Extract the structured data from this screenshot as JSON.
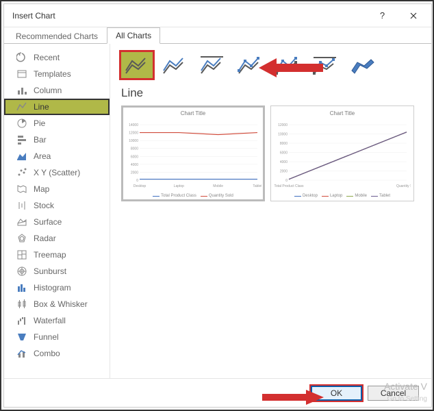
{
  "titlebar": {
    "title": "Insert Chart"
  },
  "tabs": {
    "recommended": "Recommended Charts",
    "all": "All Charts"
  },
  "sidebar": {
    "items": [
      {
        "label": "Recent",
        "icon": "recent"
      },
      {
        "label": "Templates",
        "icon": "templates"
      },
      {
        "label": "Column",
        "icon": "column"
      },
      {
        "label": "Line",
        "icon": "line"
      },
      {
        "label": "Pie",
        "icon": "pie"
      },
      {
        "label": "Bar",
        "icon": "bar"
      },
      {
        "label": "Area",
        "icon": "area"
      },
      {
        "label": "X Y (Scatter)",
        "icon": "scatter"
      },
      {
        "label": "Map",
        "icon": "map"
      },
      {
        "label": "Stock",
        "icon": "stock"
      },
      {
        "label": "Surface",
        "icon": "surface"
      },
      {
        "label": "Radar",
        "icon": "radar"
      },
      {
        "label": "Treemap",
        "icon": "treemap"
      },
      {
        "label": "Sunburst",
        "icon": "sunburst"
      },
      {
        "label": "Histogram",
        "icon": "histogram"
      },
      {
        "label": "Box & Whisker",
        "icon": "box"
      },
      {
        "label": "Waterfall",
        "icon": "waterfall"
      },
      {
        "label": "Funnel",
        "icon": "funnel"
      },
      {
        "label": "Combo",
        "icon": "combo"
      }
    ]
  },
  "section_title": "Line",
  "preview1": {
    "title": "Chart Title",
    "xcats": [
      "Desktop",
      "Laptop",
      "Mobile",
      "Tablet"
    ],
    "legend": [
      "Total Product Class",
      "Quantity Sold"
    ]
  },
  "preview2": {
    "title": "Chart Title",
    "xcats": [
      "Total Product Class",
      "Quantity Sold"
    ],
    "legend": [
      "Desktop",
      "Laptop",
      "Mobile",
      "Tablet"
    ]
  },
  "chart_data": [
    {
      "type": "line",
      "title": "Chart Title",
      "categories": [
        "Desktop",
        "Laptop",
        "Mobile",
        "Tablet"
      ],
      "series": [
        {
          "name": "Total Product Class",
          "values": [
            250,
            250,
            250,
            250
          ],
          "color": "#3f6fbf"
        },
        {
          "name": "Quantity Sold",
          "values": [
            12000,
            12000,
            11500,
            12000
          ],
          "color": "#d04b3b"
        }
      ],
      "ylim": [
        0,
        14000
      ],
      "yticks": [
        0,
        2000,
        4000,
        6000,
        8000,
        10000,
        12000,
        14000
      ]
    },
    {
      "type": "line",
      "title": "Chart Title",
      "categories": [
        "Total Product Class",
        "Quantity Sold"
      ],
      "series": [
        {
          "name": "Desktop",
          "values": [
            200,
            10400
          ],
          "color": "#3f6fbf"
        },
        {
          "name": "Laptop",
          "values": [
            200,
            10400
          ],
          "color": "#d04b3b"
        },
        {
          "name": "Mobile",
          "values": [
            200,
            10400
          ],
          "color": "#8ea84a"
        },
        {
          "name": "Tablet",
          "values": [
            200,
            10400
          ],
          "color": "#6b5b8f"
        }
      ],
      "ylim": [
        0,
        12000
      ],
      "yticks": [
        0,
        2000,
        4000,
        6000,
        8000,
        10000,
        12000
      ]
    }
  ],
  "buttons": {
    "ok": "OK",
    "cancel": "Cancel"
  },
  "watermark": {
    "line1": "Activate V",
    "line2": "Go to Setting"
  },
  "colors": {
    "highlight_bg": "#b0b848",
    "assist_red": "#d32f2f"
  }
}
